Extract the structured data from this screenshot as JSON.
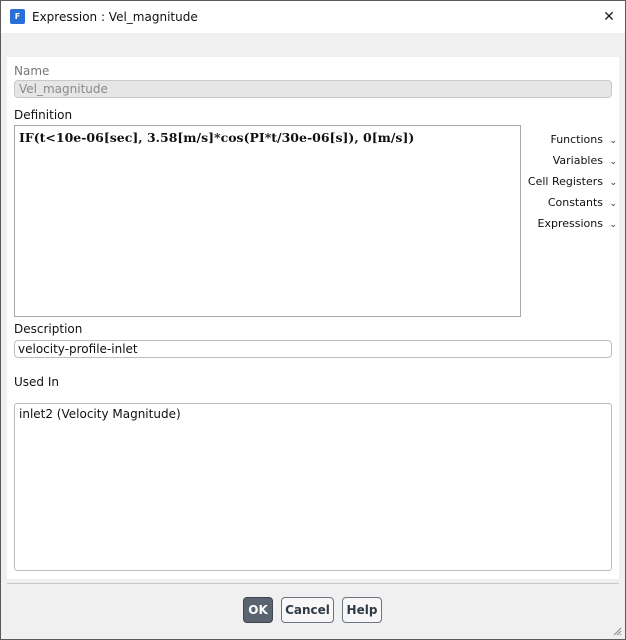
{
  "window": {
    "title": "Expression : Vel_magnitude",
    "app_icon_letter": "F",
    "close_glyph": "✕"
  },
  "name": {
    "label": "Name",
    "value": "Vel_magnitude"
  },
  "definition": {
    "label": "Definition",
    "value": "IF(t<10e-06[sec], 3.58[m/s]*cos(PI*t/30e-06[s]), 0[m/s])"
  },
  "side_menu": [
    {
      "label": "Functions"
    },
    {
      "label": "Variables"
    },
    {
      "label": "Cell Registers"
    },
    {
      "label": "Constants"
    },
    {
      "label": "Expressions"
    }
  ],
  "description": {
    "label": "Description",
    "value": "velocity-profile-inlet"
  },
  "used_in": {
    "label": "Used In",
    "items": [
      "inlet2 (Velocity Magnitude)"
    ]
  },
  "buttons": {
    "ok": "OK",
    "cancel": "Cancel",
    "help": "Help"
  },
  "colors": {
    "accent": "#2a6fd6",
    "primary_button": "#5a6470"
  }
}
